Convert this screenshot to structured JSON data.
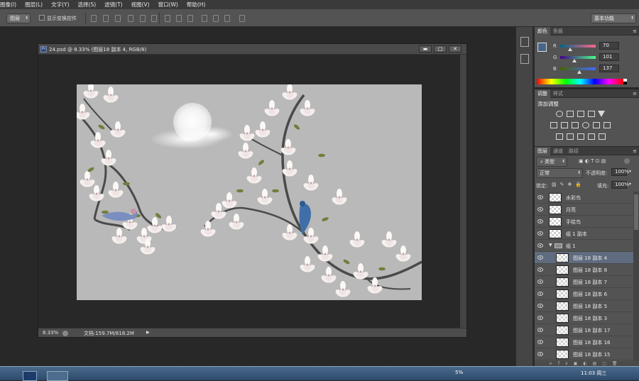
{
  "menu": [
    "图像(I)",
    "图层(L)",
    "文字(Y)",
    "选择(S)",
    "滤镜(T)",
    "视图(V)",
    "窗口(W)",
    "帮助(H)"
  ],
  "options": {
    "layer_select": "图层",
    "show_transform_label": "显示变换控件",
    "workspace": "基本功能"
  },
  "document": {
    "title": "24.psd @ 8.33% (图层18 副本 4, RGB/8)",
    "zoom": "8.33%",
    "doc_size": "文档:159.7M/818.2M"
  },
  "color_panel": {
    "tabs": [
      "颜色",
      "色板"
    ],
    "r_label": "R",
    "g_label": "G",
    "b_label": "B",
    "r": "70",
    "g": "101",
    "b": "137",
    "r_fraction": 0.275,
    "g_fraction": 0.396,
    "b_fraction": 0.537,
    "foreground_color": "#466589"
  },
  "adjust_panel": {
    "tabs": [
      "调整",
      "样式"
    ],
    "heading": "添加调整"
  },
  "layers_panel": {
    "tabs": [
      "图层",
      "通道",
      "路径"
    ],
    "filter_label": "类型",
    "blend_mode": "正常",
    "opacity_label": "不透明度:",
    "opacity": "100%",
    "lock_label": "锁定:",
    "fill_label": "填充:",
    "fill": "100%",
    "layers": [
      {
        "name": "水彩鸟",
        "indent": 0,
        "selected": false,
        "group": false
      },
      {
        "name": "月亮",
        "indent": 0,
        "selected": false,
        "group": false
      },
      {
        "name": "手绘鸟",
        "indent": 0,
        "selected": false,
        "group": false
      },
      {
        "name": "组 1 副本",
        "indent": 0,
        "selected": false,
        "group": false
      },
      {
        "name": "组 1",
        "indent": 0,
        "selected": false,
        "group": true
      },
      {
        "name": "图层 18 副本 4",
        "indent": 1,
        "selected": true,
        "group": false
      },
      {
        "name": "图层 18 副本 8",
        "indent": 1,
        "selected": false,
        "group": false
      },
      {
        "name": "图层 18 副本 7",
        "indent": 1,
        "selected": false,
        "group": false
      },
      {
        "name": "图层 18 副本 6",
        "indent": 1,
        "selected": false,
        "group": false
      },
      {
        "name": "图层 18 副本 5",
        "indent": 1,
        "selected": false,
        "group": false
      },
      {
        "name": "图层 18 副本 3",
        "indent": 1,
        "selected": false,
        "group": false
      },
      {
        "name": "图层 18 副本 17",
        "indent": 1,
        "selected": false,
        "group": false
      },
      {
        "name": "图层 18 副本 16",
        "indent": 1,
        "selected": false,
        "group": false
      },
      {
        "name": "图层 18 副本 15",
        "indent": 1,
        "selected": false,
        "group": false
      }
    ]
  },
  "taskbar": {
    "percent": "5%",
    "time": "11:03 周三"
  }
}
